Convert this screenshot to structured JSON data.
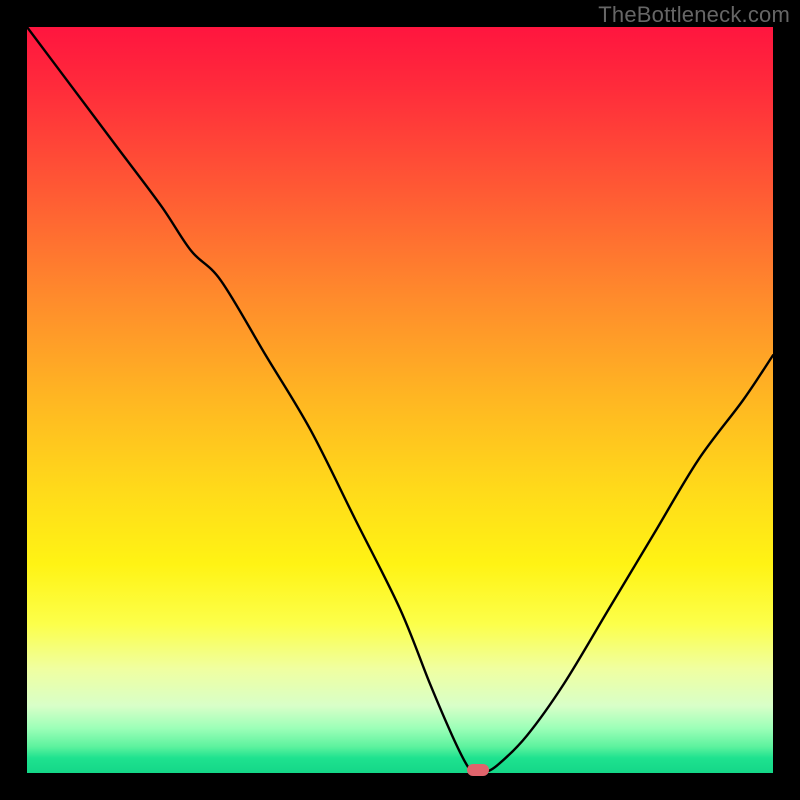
{
  "watermark": "TheBottleneck.com",
  "colors": {
    "frame": "#000000",
    "curve": "#000000",
    "marker": "#e0646c",
    "gradient_top": "#ff153f",
    "gradient_bottom": "#14d788"
  },
  "chart_data": {
    "type": "line",
    "title": "",
    "xlabel": "",
    "ylabel": "",
    "xlim": [
      0,
      100
    ],
    "ylim": [
      0,
      100
    ],
    "x": [
      0,
      6,
      12,
      18,
      22,
      26,
      32,
      38,
      44,
      50,
      54,
      57,
      59,
      60,
      61,
      63,
      67,
      72,
      78,
      84,
      90,
      96,
      100
    ],
    "values": [
      100,
      92,
      84,
      76,
      70,
      66,
      56,
      46,
      34,
      22,
      12,
      5,
      1,
      0,
      0,
      1,
      5,
      12,
      22,
      32,
      42,
      50,
      56
    ],
    "marker": {
      "x": 60.5,
      "y": 0
    },
    "annotations": []
  }
}
